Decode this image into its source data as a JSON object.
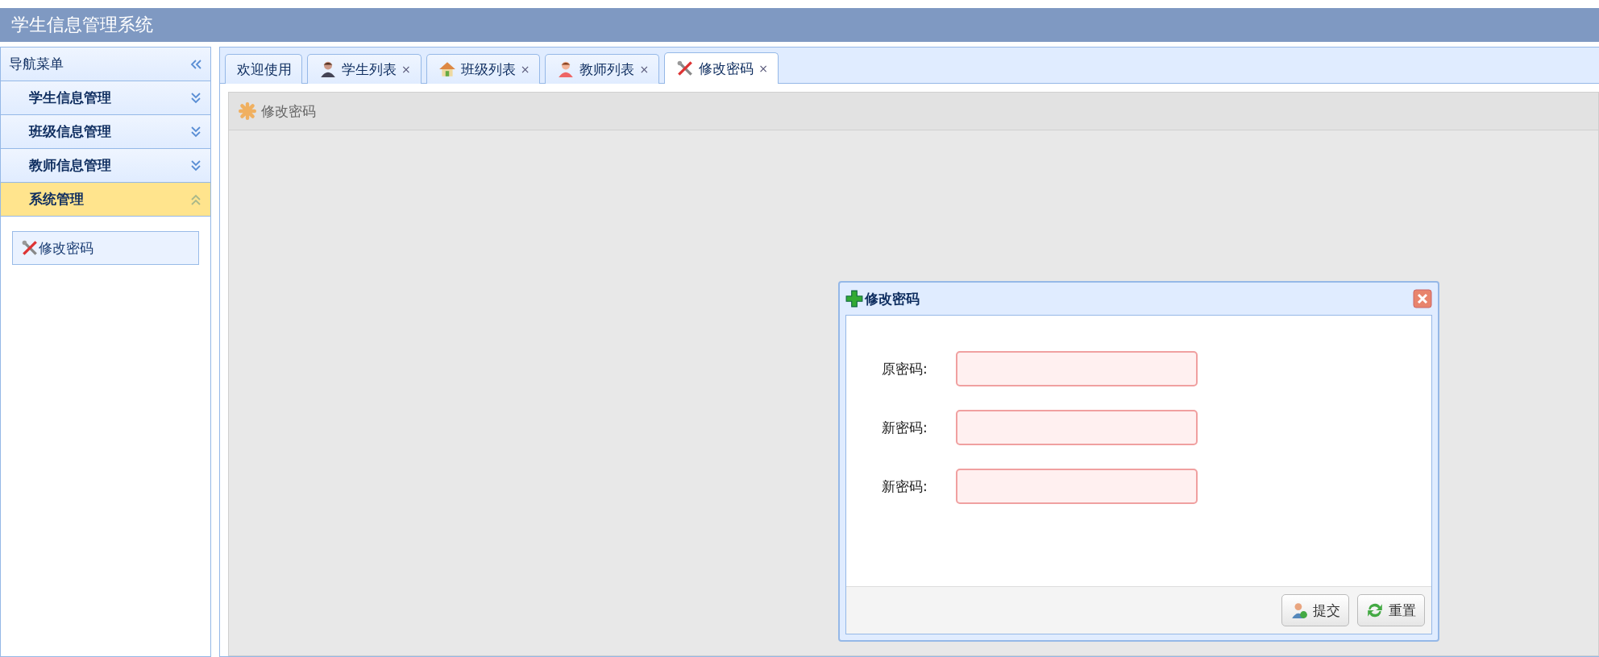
{
  "app_title": "学生信息管理系统",
  "sidebar": {
    "title": "导航菜单",
    "sections": [
      {
        "label": "学生信息管理",
        "expanded": false
      },
      {
        "label": "班级信息管理",
        "expanded": false
      },
      {
        "label": "教师信息管理",
        "expanded": false
      },
      {
        "label": "系统管理",
        "expanded": true,
        "items": [
          {
            "label": "修改密码"
          }
        ]
      }
    ]
  },
  "tabs": [
    {
      "label": "欢迎使用",
      "selected": false
    },
    {
      "label": "学生列表",
      "close": "×",
      "selected": false
    },
    {
      "label": "班级列表",
      "close": "×",
      "selected": false
    },
    {
      "label": "教师列表",
      "close": "×",
      "selected": false
    },
    {
      "label": "修改密码",
      "close": "×",
      "selected": true
    }
  ],
  "panel": {
    "title": "修改密码"
  },
  "dialog": {
    "title": "修改密码",
    "fields": [
      {
        "label": "原密码:",
        "invalid": true
      },
      {
        "label": "新密码:",
        "invalid": true
      },
      {
        "label": "新密码:",
        "invalid": true
      }
    ],
    "buttons": [
      {
        "label": "提交"
      },
      {
        "label": "重置"
      }
    ]
  }
}
